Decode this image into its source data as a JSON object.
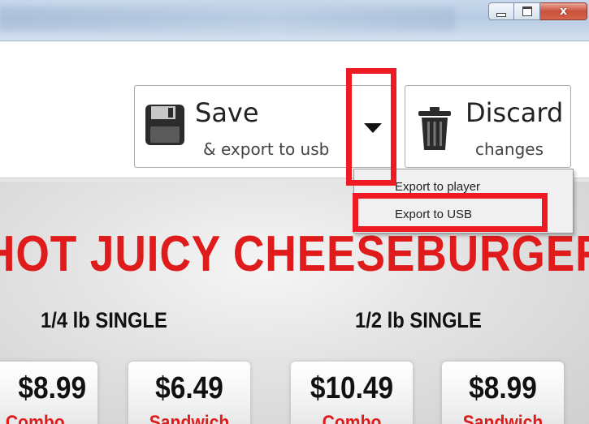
{
  "window": {
    "controls": [
      "minimize",
      "maximize",
      "close"
    ],
    "close_glyph": "x"
  },
  "toolbar": {
    "save_label": "Save",
    "save_sub": "& export to usb",
    "discard_label": "Discard",
    "discard_sub": "changes",
    "icons": [
      "floppy-disk-icon",
      "chevron-down-icon",
      "trash-icon"
    ]
  },
  "popup": {
    "items": [
      {
        "label": "Export to player"
      },
      {
        "label": "Export to USB"
      }
    ]
  },
  "menu_board": {
    "headline": "HOT JUICY CHEESEBURGER",
    "sizes": [
      "1/4 lb SINGLE",
      "1/2 lb SINGLE"
    ],
    "cards": [
      {
        "price": "$8.99",
        "type": "Combo"
      },
      {
        "price": "$6.49",
        "type": "Sandwich"
      },
      {
        "price": "$10.49",
        "type": "Combo"
      },
      {
        "price": "$8.99",
        "type": "Sandwich"
      }
    ]
  },
  "colors": {
    "highlight": "#ee1b24",
    "headline_red": "#e01b1b",
    "titlebar": "#c9d9ec"
  }
}
